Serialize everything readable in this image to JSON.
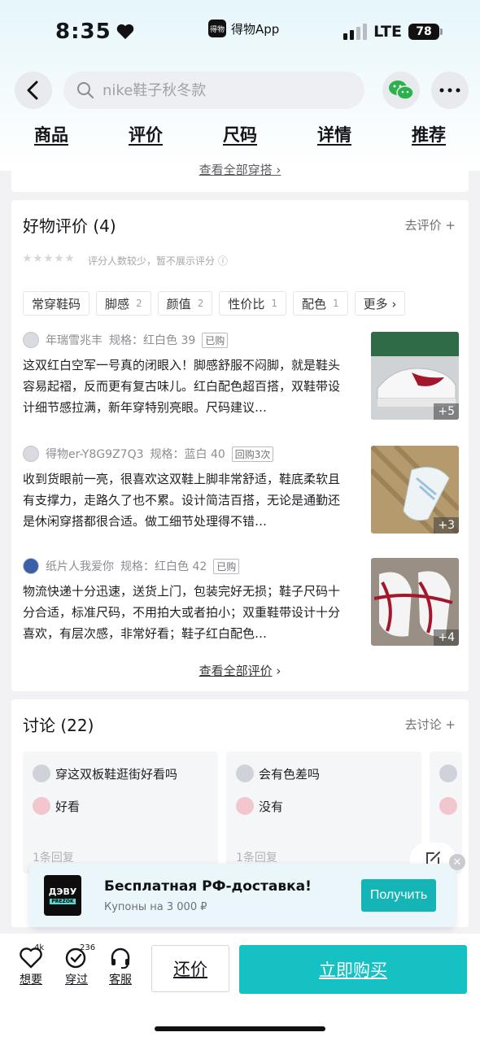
{
  "status": {
    "time": "8:35",
    "app_label": "得物App",
    "network": "LTE",
    "battery": "78"
  },
  "header": {
    "search_placeholder": "nike鞋子秋冬款"
  },
  "tabs": [
    "商品",
    "评价",
    "尺码",
    "详情",
    "推荐"
  ],
  "outfits_link": "查看全部穿搭 ›",
  "reviews": {
    "title": "好物评价 (4)",
    "action": "去评价 +",
    "rating_note": "评分人数较少，暂不展示评分 ⓘ",
    "chips": [
      {
        "label": "常穿鞋码",
        "count": ""
      },
      {
        "label": "脚感",
        "count": "2"
      },
      {
        "label": "颜值",
        "count": "2"
      },
      {
        "label": "性价比",
        "count": "1"
      },
      {
        "label": "配色",
        "count": "1"
      },
      {
        "label": "更多 ›",
        "count": ""
      }
    ],
    "items": [
      {
        "user": "年瑞雪兆丰",
        "spec": "规格：红白色 39",
        "tag": "已购",
        "text": "这双红白空军一号真的闭眼入！脚感舒服不闷脚，就是鞋头容易起褶，反而更有复古味儿。红白配色超百搭，双鞋带设计细节感拉满，新年穿特别亮眼。尺码建议…",
        "more": "+5"
      },
      {
        "user": "得物er-Y8G9Z7Q3",
        "spec": "规格：蓝白 40",
        "tag": "回购3次",
        "text": "收到货眼前一亮，很喜欢这双鞋上脚非常舒适，鞋底柔软且有支撑力，走路久了也不累。设计简洁百搭，无论是通勤还是休闲穿搭都很合适。做工细节处理得不错…",
        "more": "+3"
      },
      {
        "user": "纸片人我爱你",
        "spec": "规格：红白色 42",
        "tag": "已购",
        "text": "物流快递十分迅速，送货上门，包装完好无损；鞋子尺码十分合适，标准尺码，不用拍大或者拍小；双重鞋带设计十分喜欢，有层次感，非常好看；鞋子红白配色…",
        "more": "+4"
      }
    ],
    "see_all": "查看全部评价"
  },
  "discussion": {
    "title": "讨论 (22)",
    "action": "去讨论 +",
    "items": [
      {
        "question": "穿这双板鞋逛街好看吗",
        "answer": "好看",
        "replies": "1条回复"
      },
      {
        "question": "会有色差吗",
        "answer": "没有",
        "replies": "1条回复"
      }
    ]
  },
  "banner": {
    "logo": "ДЭВУ",
    "logo_sub": "PREZOK",
    "title": "Бесплатная РФ-доставка!",
    "subtitle": "Купоны на 3 000 ₽",
    "button": "Получить"
  },
  "bottom": {
    "want_label": "想要",
    "want_count": "4k",
    "worn_label": "穿过",
    "worn_count": "236",
    "service_label": "客服",
    "bargain": "还价",
    "buy": "立即购买"
  },
  "colors": {
    "accent": "#15c1c3",
    "text": "#14151a",
    "muted": "#8b8d93"
  }
}
